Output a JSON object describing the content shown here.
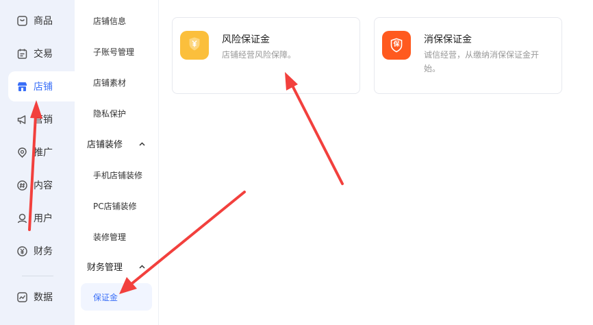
{
  "nav": {
    "items": [
      {
        "label": "商品",
        "icon": "product-icon"
      },
      {
        "label": "交易",
        "icon": "trade-icon"
      },
      {
        "label": "店铺",
        "icon": "store-icon",
        "active": true
      },
      {
        "label": "营销",
        "icon": "megaphone-icon"
      },
      {
        "label": "推广",
        "icon": "promotion-icon"
      },
      {
        "label": "内容",
        "icon": "content-icon"
      },
      {
        "label": "用户",
        "icon": "user-icon"
      },
      {
        "label": "财务",
        "icon": "finance-icon"
      },
      {
        "label": "数据",
        "icon": "data-icon"
      }
    ]
  },
  "submenu": {
    "items": [
      {
        "label": "店铺信息"
      },
      {
        "label": "子账号管理"
      },
      {
        "label": "店铺素材"
      },
      {
        "label": "隐私保护"
      }
    ],
    "group_decor": {
      "label": "店铺装修"
    },
    "decor_items": [
      {
        "label": "手机店铺装修"
      },
      {
        "label": "PC店铺装修"
      },
      {
        "label": "装修管理"
      }
    ],
    "group_finance": {
      "label": "财务管理"
    },
    "finance_items": [
      {
        "label": "保证金",
        "active": true
      }
    ]
  },
  "cards": [
    {
      "title": "风险保证金",
      "desc": "店铺经营风险保障。",
      "badge_glyph": "¥",
      "color": "#fbbf3c"
    },
    {
      "title": "消保保证金",
      "desc": "诚信经营，从缴纳消保保证金开始。",
      "badge_glyph": "保",
      "color": "#ff5a1f"
    }
  ],
  "colors": {
    "accent": "#3a6ff7",
    "arrow": "#f2403d"
  }
}
